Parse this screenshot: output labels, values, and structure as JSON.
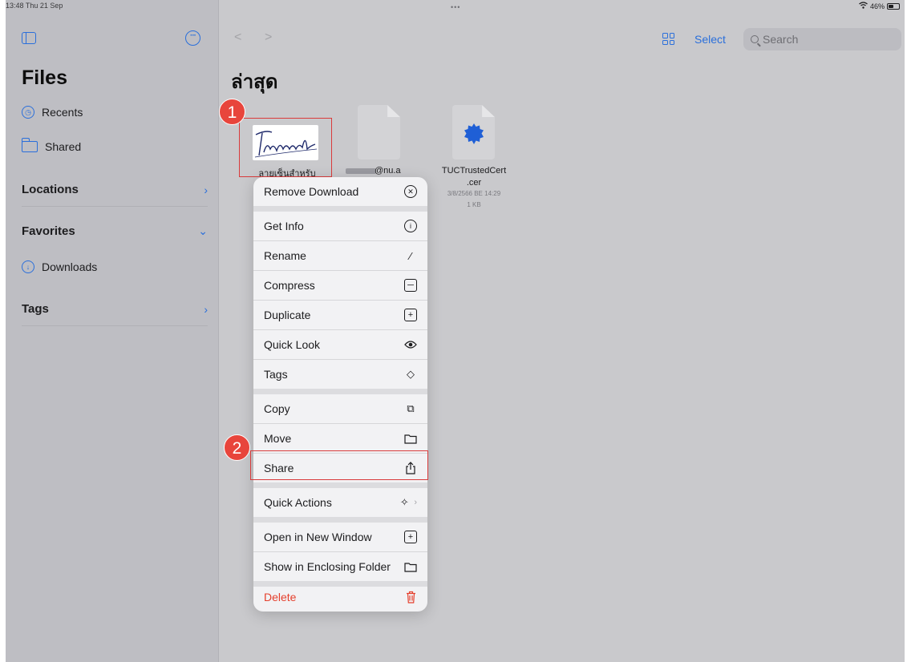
{
  "status_bar": {
    "time": "13:48  Thu 21 Sep",
    "dots": "•••",
    "battery": "46%"
  },
  "sidebar": {
    "title": "Files",
    "recents": "Recents",
    "shared": "Shared",
    "locations": "Locations",
    "favorites": "Favorites",
    "downloads": "Downloads",
    "tags": "Tags"
  },
  "toolbar": {
    "back": "<",
    "forward": ">",
    "select_label": "Select",
    "search_placeholder": "Search"
  },
  "main": {
    "title": "ล่าสุด",
    "files": [
      {
        "name": "ลายเซ็นสำหรับ",
        "thumb_text": "Thanawal"
      },
      {
        "name": "@nu.a"
      },
      {
        "name_line1": "TUCTrustedCert",
        "name_line2": ".cer",
        "date": "3/8/2566 BE 14:29",
        "size": "1 KB"
      }
    ]
  },
  "annotations": {
    "step1": "1",
    "step2": "2"
  },
  "context_menu": {
    "items": [
      {
        "label": "Remove Download",
        "icon": "x-circle-icon"
      },
      {
        "label": "Get Info",
        "icon": "info-icon"
      },
      {
        "label": "Rename",
        "icon": "pencil-icon"
      },
      {
        "label": "Compress",
        "icon": "archive-box-icon"
      },
      {
        "label": "Duplicate",
        "icon": "duplicate-icon"
      },
      {
        "label": "Quick Look",
        "icon": "eye-icon"
      },
      {
        "label": "Tags",
        "icon": "tag-icon"
      },
      {
        "label": "Copy",
        "icon": "copy-icon"
      },
      {
        "label": "Move",
        "icon": "folder-icon"
      },
      {
        "label": "Share",
        "icon": "share-icon"
      },
      {
        "label": "Quick Actions",
        "icon": "sparkles-icon"
      },
      {
        "label": "Open in New Window",
        "icon": "plus-square-icon"
      },
      {
        "label": "Show in Enclosing Folder",
        "icon": "folder-icon"
      },
      {
        "label": "Delete",
        "icon": "trash-icon"
      }
    ]
  },
  "colors": {
    "accent": "#2a6fdb",
    "destructive": "#e5402d",
    "highlight": "#d93b3b",
    "badge": "#e8453c"
  }
}
